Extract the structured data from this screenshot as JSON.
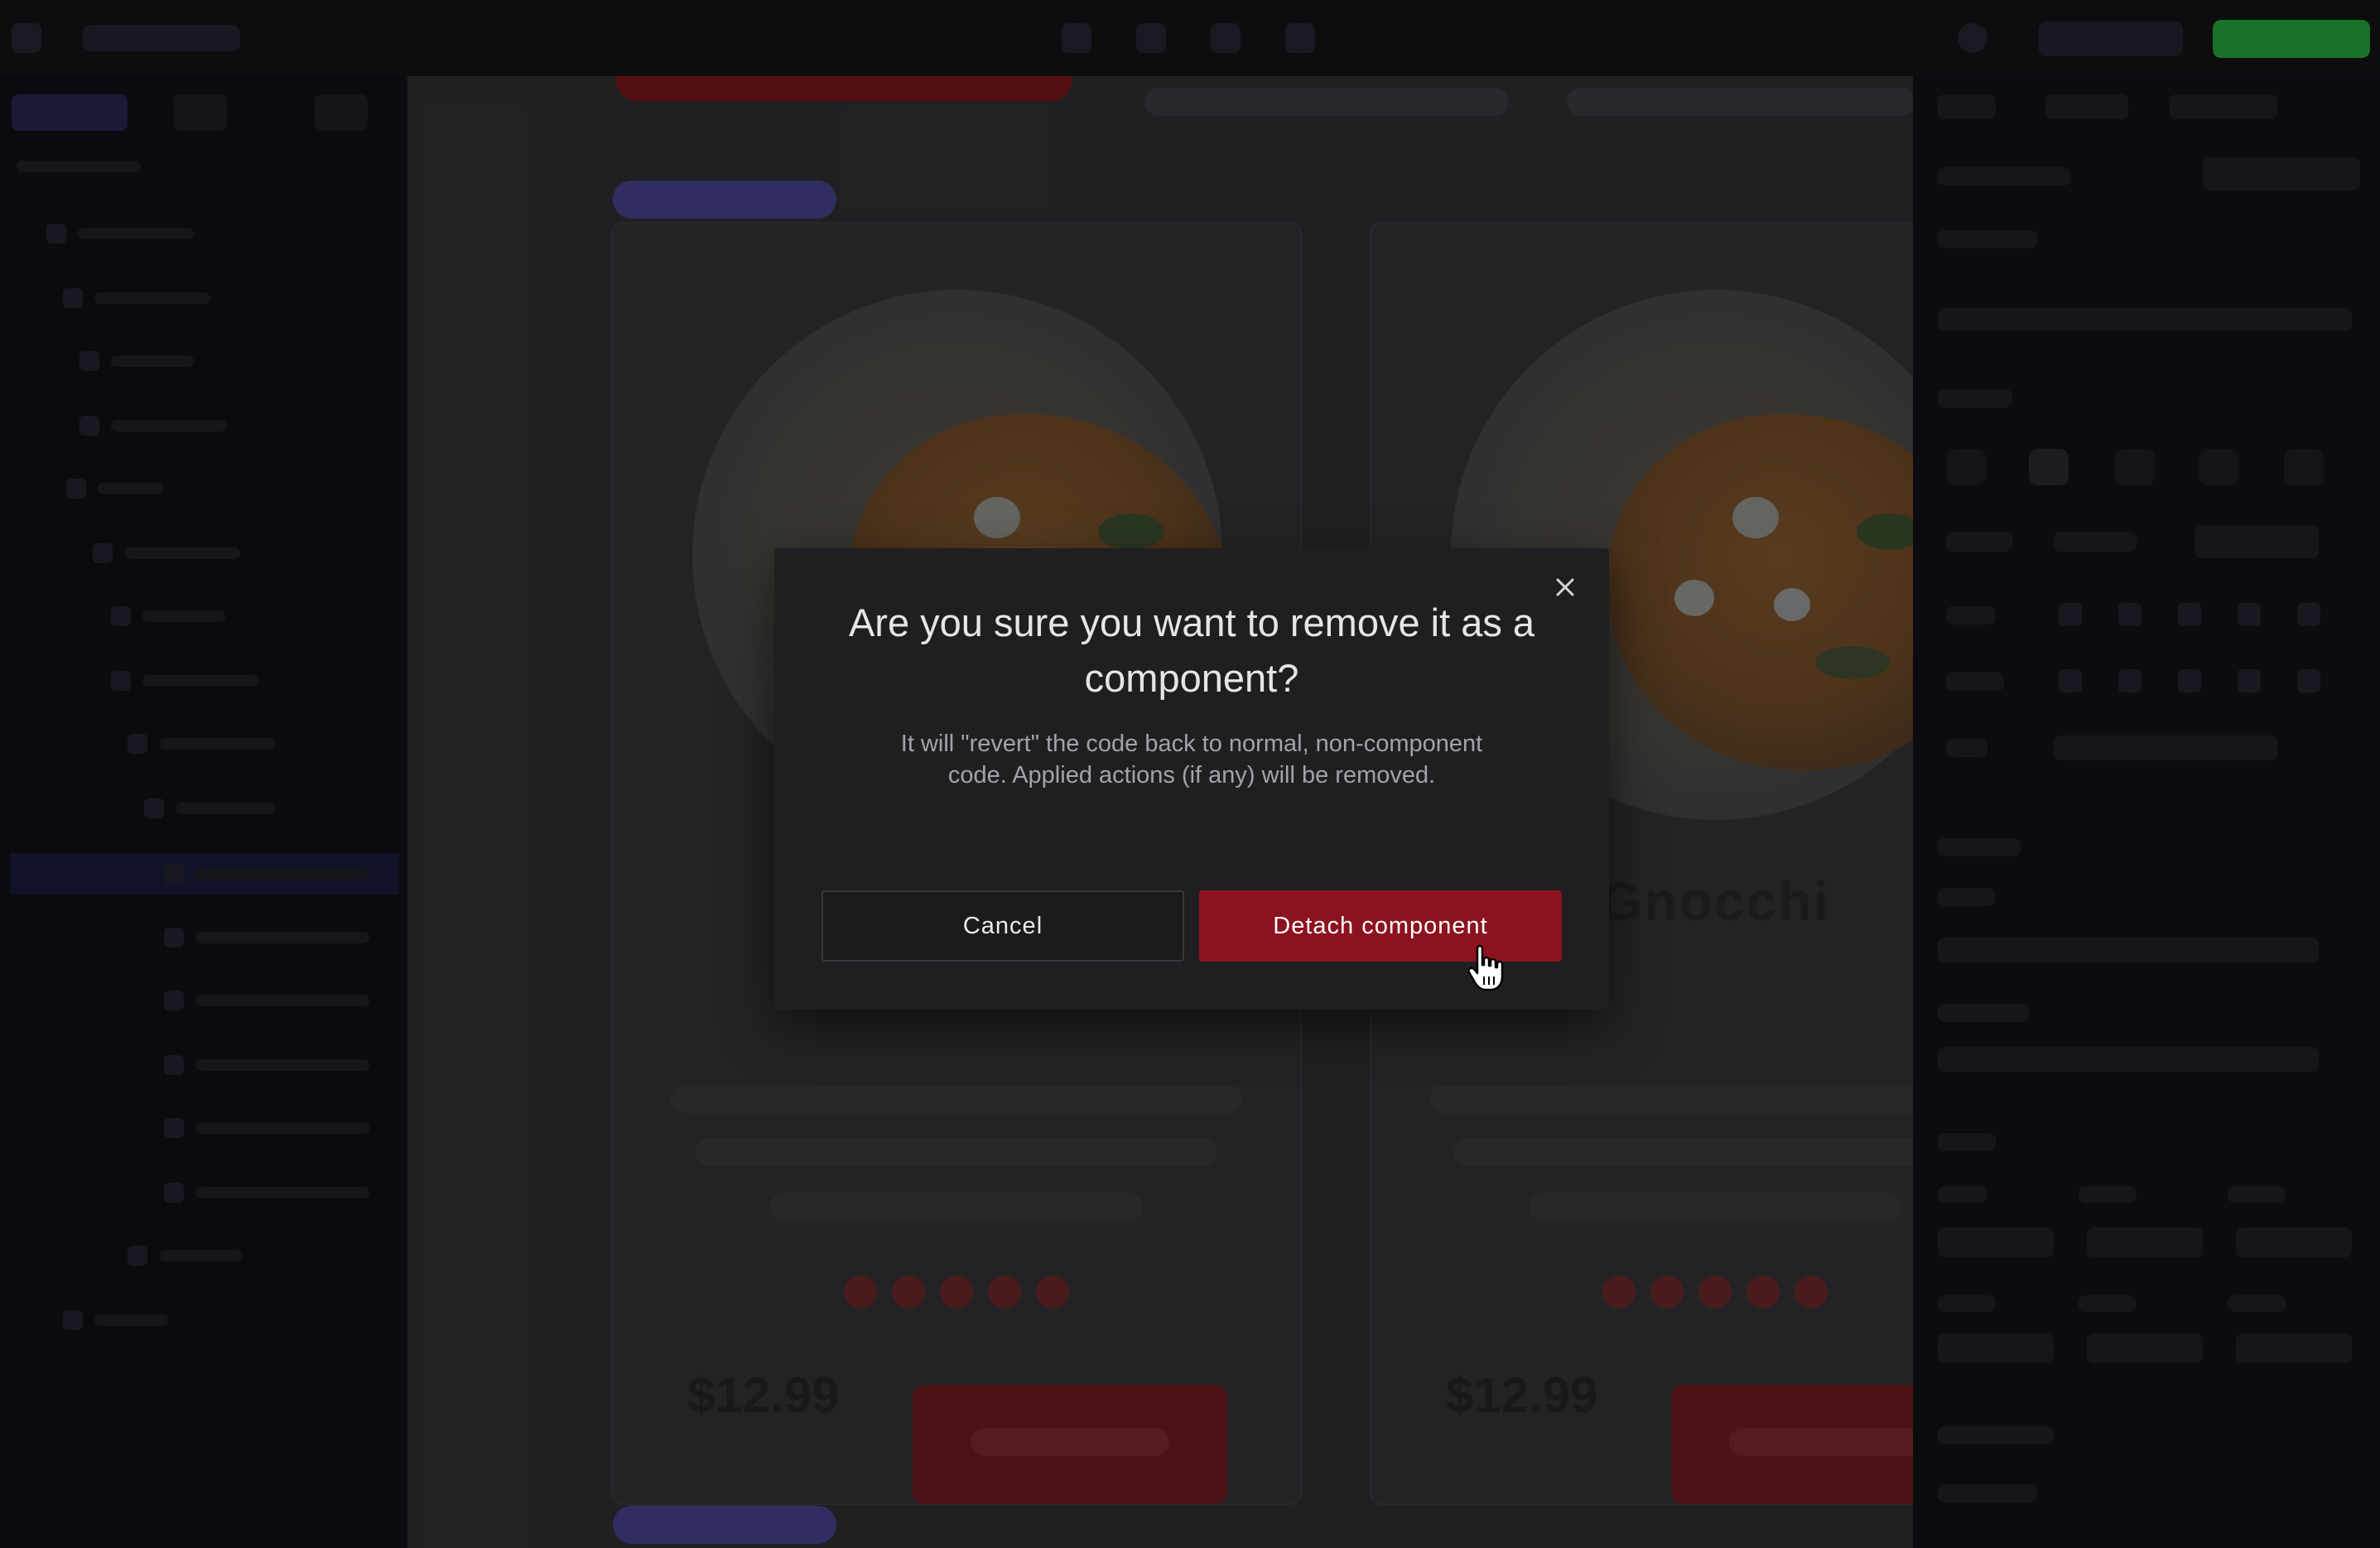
{
  "canvas": {
    "card_title": "Gnocchi",
    "price": "$12.99"
  },
  "modal": {
    "title": "Are you sure you want to remove it as a component?",
    "description": "It will \"revert\" the code back to normal, non-component code. Applied actions (if any) will be removed.",
    "cancel_label": "Cancel",
    "confirm_label": "Detach component",
    "close_icon": "close-icon"
  },
  "colors": {
    "modal_background": "#1f1f21",
    "confirm_button": "#8d1220",
    "accent_purple": "#333066",
    "publish_green": "#1a7a2a"
  }
}
